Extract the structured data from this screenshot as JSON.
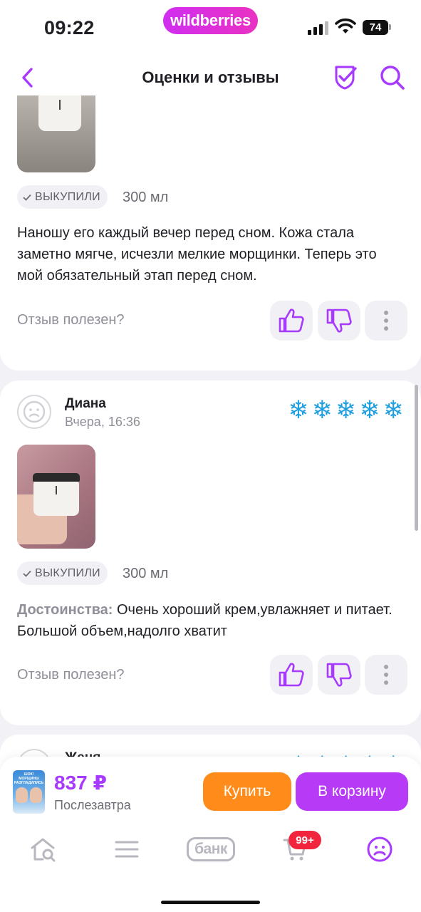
{
  "status_bar": {
    "time": "09:22",
    "app_pill": "wildberries",
    "battery": "74"
  },
  "header": {
    "title": "Оценки и отзывы",
    "back_icon": "chevron-left-icon",
    "verify_icon": "shield-check-icon",
    "search_icon": "search-icon"
  },
  "colors": {
    "accent": "#a73afd",
    "buy": "#ff8c1a",
    "cart": "#b73af7",
    "rating": "#1f9fe0",
    "badge_red": "#f2253f"
  },
  "reviews": [
    {
      "badge": "ВЫКУПИЛИ",
      "volume": "300 мл",
      "text": "Наношу его каждый вечер перед сном. Кожа стала заметно мягче, исчезли мелкие морщинки. Теперь это мой обязательный этап перед сном.",
      "helpful": "Отзыв полезен?"
    },
    {
      "author": "Диана",
      "date": "Вчера, 16:36",
      "rating": 5,
      "rating_icon": "❄",
      "badge": "ВЫКУПИЛИ",
      "volume": "300 мл",
      "pros_label": "Достоинства:",
      "text": " Очень хороший крем,увлажняет и питает. Большой объем,надолго хватит",
      "helpful": "Отзыв полезен?"
    },
    {
      "author": "Женя",
      "rating": 5
    }
  ],
  "product": {
    "thumb_text": "ШОК! МОРЩИНЫ РАЗГЛАДИЛИСЬ",
    "price": "837 ₽",
    "delivery": "Послезавтра",
    "buy_label": "Купить",
    "cart_label": "В корзину"
  },
  "tabbar": {
    "items": [
      "home-search-icon",
      "menu-icon",
      "bank",
      "cart-icon",
      "profile-icon"
    ],
    "bank_label": "банк",
    "cart_badge": "99+"
  }
}
